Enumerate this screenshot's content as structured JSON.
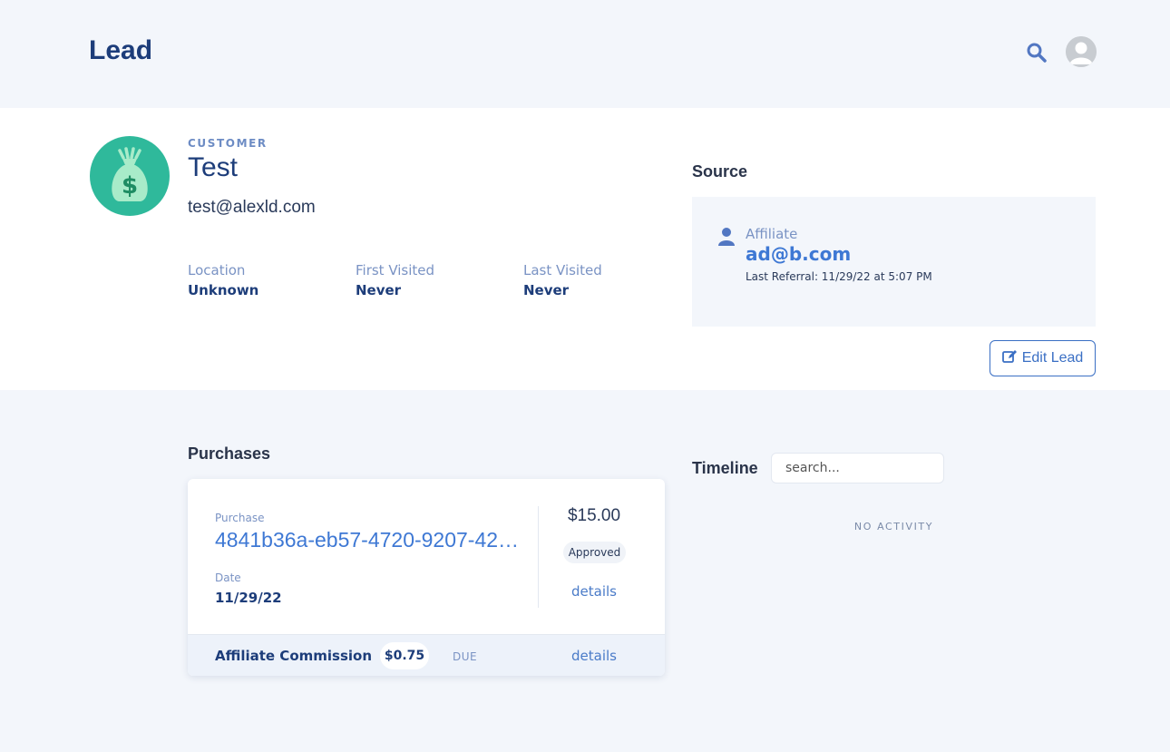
{
  "header": {
    "title": "Lead",
    "search_icon": "search-icon",
    "avatar_icon": "user-avatar"
  },
  "lead": {
    "type_label": "CUSTOMER",
    "name": "Test",
    "email": "test@alexld.com",
    "icon": "money-bag-icon",
    "meta": [
      {
        "label": "Location",
        "value": "Unknown"
      },
      {
        "label": "First Visited",
        "value": "Never"
      },
      {
        "label": "Last Visited",
        "value": "Never"
      }
    ]
  },
  "source": {
    "heading": "Source",
    "affiliate_label": "Affiliate",
    "affiliate_email": "ad@b.com",
    "last_referral": "Last Referral: 11/29/22 at 5:07 PM"
  },
  "edit_button": {
    "label": "Edit Lead",
    "icon": "edit-icon"
  },
  "purchases": {
    "heading": "Purchases",
    "items": [
      {
        "purchase_label": "Purchase",
        "id": "4841b36a-eb57-4720-9207-42…",
        "date_label": "Date",
        "date": "11/29/22",
        "amount": "$15.00",
        "status": "Approved",
        "details": "details",
        "commission": {
          "label": "Affiliate Commission",
          "amount": "$0.75",
          "status": "DUE",
          "details": "details"
        }
      }
    ]
  },
  "timeline": {
    "heading": "Timeline",
    "search_placeholder": "search...",
    "empty_text": "NO ACTIVITY"
  },
  "colors": {
    "brand_blue": "#1d3d7a",
    "link_blue": "#3e78d4",
    "lead_icon_green": "#2fb99b",
    "page_bg": "#f3f6fb"
  }
}
